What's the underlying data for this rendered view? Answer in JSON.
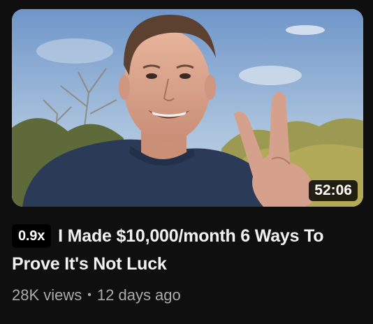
{
  "video": {
    "duration": "52:06",
    "speed_badge": "0.9x",
    "title": "I Made $10,000/month 6 Ways To Prove It's Not Luck",
    "views": "28K views",
    "separator": "•",
    "age": "12 days ago"
  },
  "colors": {
    "background": "#0f0f0f",
    "title_text": "#f1f1f1",
    "meta_text": "#aaaaaa",
    "badge_bg": "#000000",
    "duration_bg": "#000000"
  }
}
